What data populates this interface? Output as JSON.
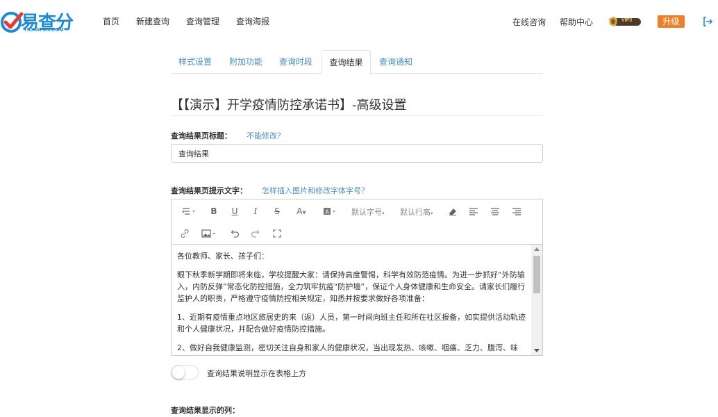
{
  "brand": {
    "name": "易查分",
    "domain": "YICHAFEN.COM",
    "color": "#1b8ad9"
  },
  "nav": [
    "首页",
    "新建查询",
    "查询管理",
    "查询海报"
  ],
  "right_nav": {
    "consult": "在线咨询",
    "help": "帮助中心",
    "vip": "VIP3",
    "upgrade": "升级"
  },
  "tabs": [
    {
      "label": "样式设置",
      "active": false
    },
    {
      "label": "附加功能",
      "active": false
    },
    {
      "label": "查询时段",
      "active": false
    },
    {
      "label": "查询结果",
      "active": true
    },
    {
      "label": "查询通知",
      "active": false
    }
  ],
  "page_title": "【【演示】开学疫情防控承诺书】-高级设置",
  "result_title": {
    "label": "查询结果页标题：",
    "help": "不能修改？",
    "value": "查询结果"
  },
  "result_tip": {
    "label": "查询结果页提示文字：",
    "help": "怎样插入图片和修改字体字号？"
  },
  "toolbar": {
    "font_size": "默认字号",
    "line_height": "默认行高"
  },
  "editor_content": [
    "各位教师、家长、孩子们：",
    "眼下秋季新学期即将来临，学校提醒大家：请保持高度警惕，科学有效防范疫情。为进一步抓好“外防输入，内防反弹”常态化防控措施，全力筑牢抗疫“防护墙”，保证个人身体健康和生命安全。请家长们履行监护人的职责，严格遵守疫情防控相关规定，知悉并按要求做好各项准备：",
    "1、近期有疫情重点地区旅居史的来（返）人员，第一时间向班主任和所在社区报备，如实提供活动轨迹和个人健康状况，并配合做好疫情防控措施。",
    "2、做好自我健康监测，密切关注自身和家人的健康状况，当出现发热、咳嗽、咽痛、乏力、腹泻、味"
  ],
  "toggle": {
    "label": "查询结果说明显示在表格上方",
    "on": false
  },
  "columns_label": "查询结果显示的列："
}
